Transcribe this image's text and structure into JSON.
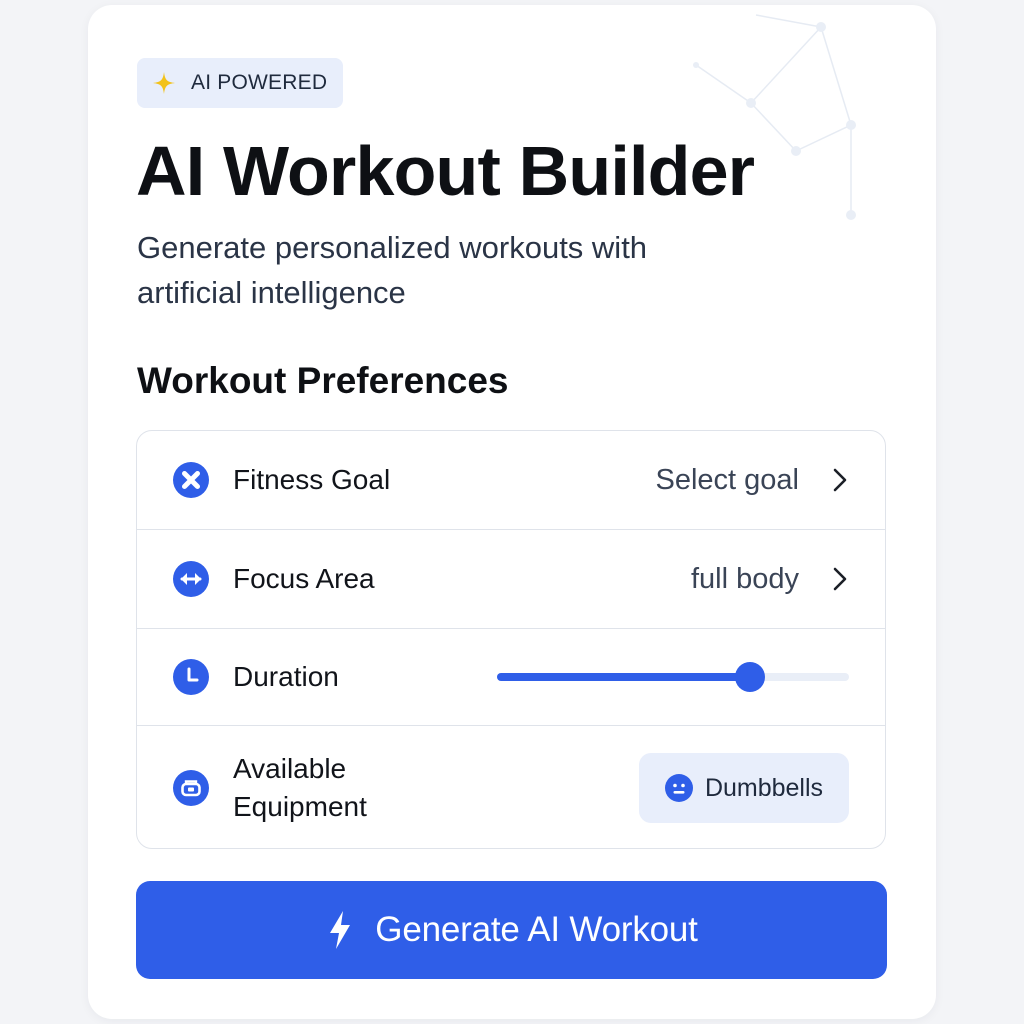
{
  "colors": {
    "accent": "#2f5ee8",
    "badge_background": "#e8eefb",
    "sparkle": "#f2c21b",
    "text_primary": "#0e1014",
    "text_secondary": "#2a3446",
    "divider": "#dfe3ea"
  },
  "badge": {
    "icon": "sparkle-icon",
    "label": "AI POWERED"
  },
  "header": {
    "title": "AI Workout Builder",
    "subtitle": "Generate personalized workouts with artificial intelligence"
  },
  "preferences": {
    "section_title": "Workout Preferences",
    "fitness_goal": {
      "icon": "target-cross-icon",
      "label": "Fitness Goal",
      "value": "Select goal"
    },
    "focus_area": {
      "icon": "arrows-horizontal-icon",
      "label": "Focus Area",
      "value": "full body"
    },
    "duration": {
      "icon": "clock-icon",
      "label": "Duration",
      "slider_fraction": 0.72
    },
    "equipment": {
      "icon": "equipment-icon",
      "label": "Available Equipment",
      "chip_icon": "dumbbell-face-icon",
      "chip_label": "Dumbbells"
    }
  },
  "generate_button": {
    "icon": "lightning-icon",
    "label": "Generate AI Workout"
  }
}
